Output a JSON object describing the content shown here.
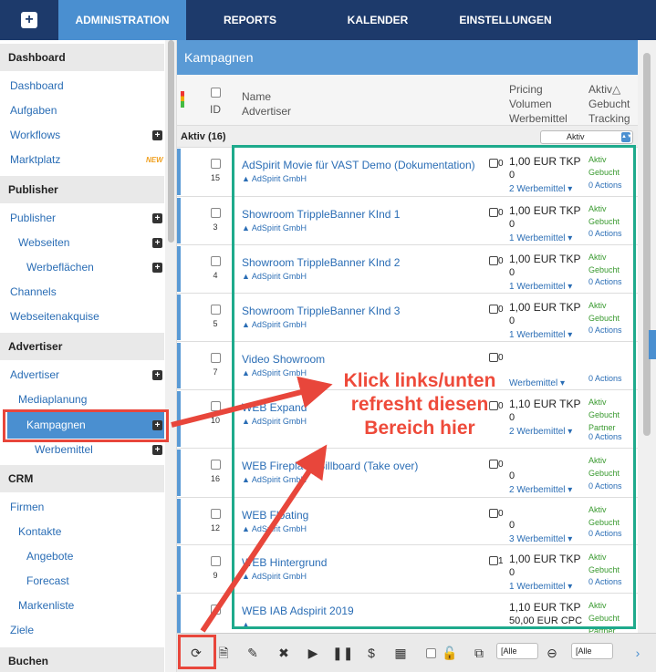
{
  "nav": {
    "plus_label": "+",
    "items": [
      "ADMINISTRATION",
      "REPORTS",
      "KALENDER",
      "EINSTELLUNGEN"
    ]
  },
  "sidebar": {
    "sections": [
      {
        "title": "Dashboard"
      },
      {
        "title": "Publisher"
      },
      {
        "title": "Advertiser"
      },
      {
        "title": "CRM"
      },
      {
        "title": "Buchen"
      }
    ],
    "links": {
      "dashboard": "Dashboard",
      "aufgaben": "Aufgaben",
      "workflows": "Workflows",
      "marktplatz": "Marktplatz",
      "marktplatz_badge": "NEW",
      "publisher": "Publisher",
      "webseiten": "Webseiten",
      "werbeflaechen": "Werbeflächen",
      "channels": "Channels",
      "webseitenakquise": "Webseitenakquise",
      "advertiser": "Advertiser",
      "mediaplanung": "Mediaplanung",
      "kampagnen": "Kampagnen",
      "werbemittel": "Werbemittel",
      "firmen": "Firmen",
      "kontakte": "Kontakte",
      "angebote": "Angebote",
      "forecast": "Forecast",
      "markenliste": "Markenliste",
      "ziele": "Ziele"
    }
  },
  "main": {
    "title": "Kampagnen",
    "headers": {
      "id": "ID",
      "name": "Name",
      "advertiser": "Advertiser",
      "pricing": "Pricing",
      "volumen": "Volumen",
      "werbemittel": "Werbemittel",
      "aktiv": "Aktiv△",
      "gebucht": "Gebucht",
      "tracking": "Tracking"
    },
    "group": {
      "label": "Aktiv (16)",
      "filter_value": "Aktiv"
    },
    "rows": [
      {
        "id": "15",
        "name": "AdSpirit Movie für VAST Demo (Dokumentation)",
        "advertiser": "AdSpirit GmbH",
        "note": "0",
        "price": "1,00 EUR TKP",
        "volume": "0",
        "werbemittel": "2 Werbemittel",
        "status": [
          "Aktiv",
          "Gebucht"
        ],
        "actions": "0 Actions"
      },
      {
        "id": "3",
        "name": "Showroom TrippleBanner KInd 1",
        "advertiser": "AdSpirit GmbH",
        "note": "0",
        "price": "1,00 EUR TKP",
        "volume": "0",
        "werbemittel": "1 Werbemittel",
        "status": [
          "Aktiv",
          "Gebucht"
        ],
        "actions": "0 Actions"
      },
      {
        "id": "4",
        "name": "Showroom TrippleBanner KInd 2",
        "advertiser": "AdSpirit GmbH",
        "note": "0",
        "price": "1,00 EUR TKP",
        "volume": "0",
        "werbemittel": "1 Werbemittel",
        "status": [
          "Aktiv",
          "Gebucht"
        ],
        "actions": "0 Actions"
      },
      {
        "id": "5",
        "name": "Showroom TrippleBanner KInd 3",
        "advertiser": "AdSpirit GmbH",
        "note": "0",
        "price": "1,00 EUR TKP",
        "volume": "0",
        "werbemittel": "1 Werbemittel",
        "status": [
          "Aktiv",
          "Gebucht"
        ],
        "actions": "0 Actions"
      },
      {
        "id": "7",
        "name": "Video Showroom",
        "advertiser": "AdSpirit GmbH",
        "note": "0",
        "price": "",
        "volume": "",
        "werbemittel": "Werbemittel",
        "status": [
          "",
          ""
        ],
        "actions": "0 Actions"
      },
      {
        "id": "10",
        "name": "WEB Expand",
        "advertiser": "AdSpirit GmbH",
        "note": "0",
        "price": "1,10 EUR TKP",
        "volume": "0",
        "werbemittel": "2 Werbemittel",
        "status": [
          "Aktiv",
          "Gebucht",
          "Partner"
        ],
        "actions": "0 Actions"
      },
      {
        "id": "16",
        "name": "WEB Fireplace Billboard (Take over)",
        "advertiser": "AdSpirit GmbH",
        "note": "0",
        "price": "",
        "volume": "0",
        "werbemittel": "2 Werbemittel",
        "status": [
          "Aktiv",
          "Gebucht"
        ],
        "actions": "0 Actions"
      },
      {
        "id": "12",
        "name": "WEB Floating",
        "advertiser": "AdSpirit GmbH",
        "note": "0",
        "price": "",
        "volume": "0",
        "werbemittel": "3 Werbemittel",
        "status": [
          "Aktiv",
          "Gebucht"
        ],
        "actions": "0 Actions"
      },
      {
        "id": "9",
        "name": "WEB Hintergrund",
        "advertiser": "AdSpirit GmbH",
        "note": "1",
        "price": "1,00 EUR TKP",
        "volume": "0",
        "werbemittel": "1 Werbemittel",
        "status": [
          "Aktiv",
          "Gebucht"
        ],
        "actions": "0 Actions"
      },
      {
        "id": "",
        "name": "WEB IAB Adspirit 2019",
        "advertiser": "",
        "note": "",
        "price": "1,10 EUR TKP",
        "volume": "50,00 EUR CPC",
        "werbemittel": "",
        "status": [
          "Aktiv",
          "Gebucht",
          "Partner"
        ],
        "actions": ""
      }
    ]
  },
  "toolbar": {
    "select1": "[Alle",
    "select2": "[Alle"
  },
  "annotation": {
    "line1": "Klick links/unten",
    "line2": "refresht diesen",
    "line3": "Bereich hier"
  },
  "colors": {
    "nav_bg": "#1d3a6b",
    "accent": "#4a8fd0",
    "link": "#2a6db5",
    "status_green": "#3a9a30",
    "annotation_red": "#e8463b",
    "annotation_green": "#1eaa8c"
  }
}
